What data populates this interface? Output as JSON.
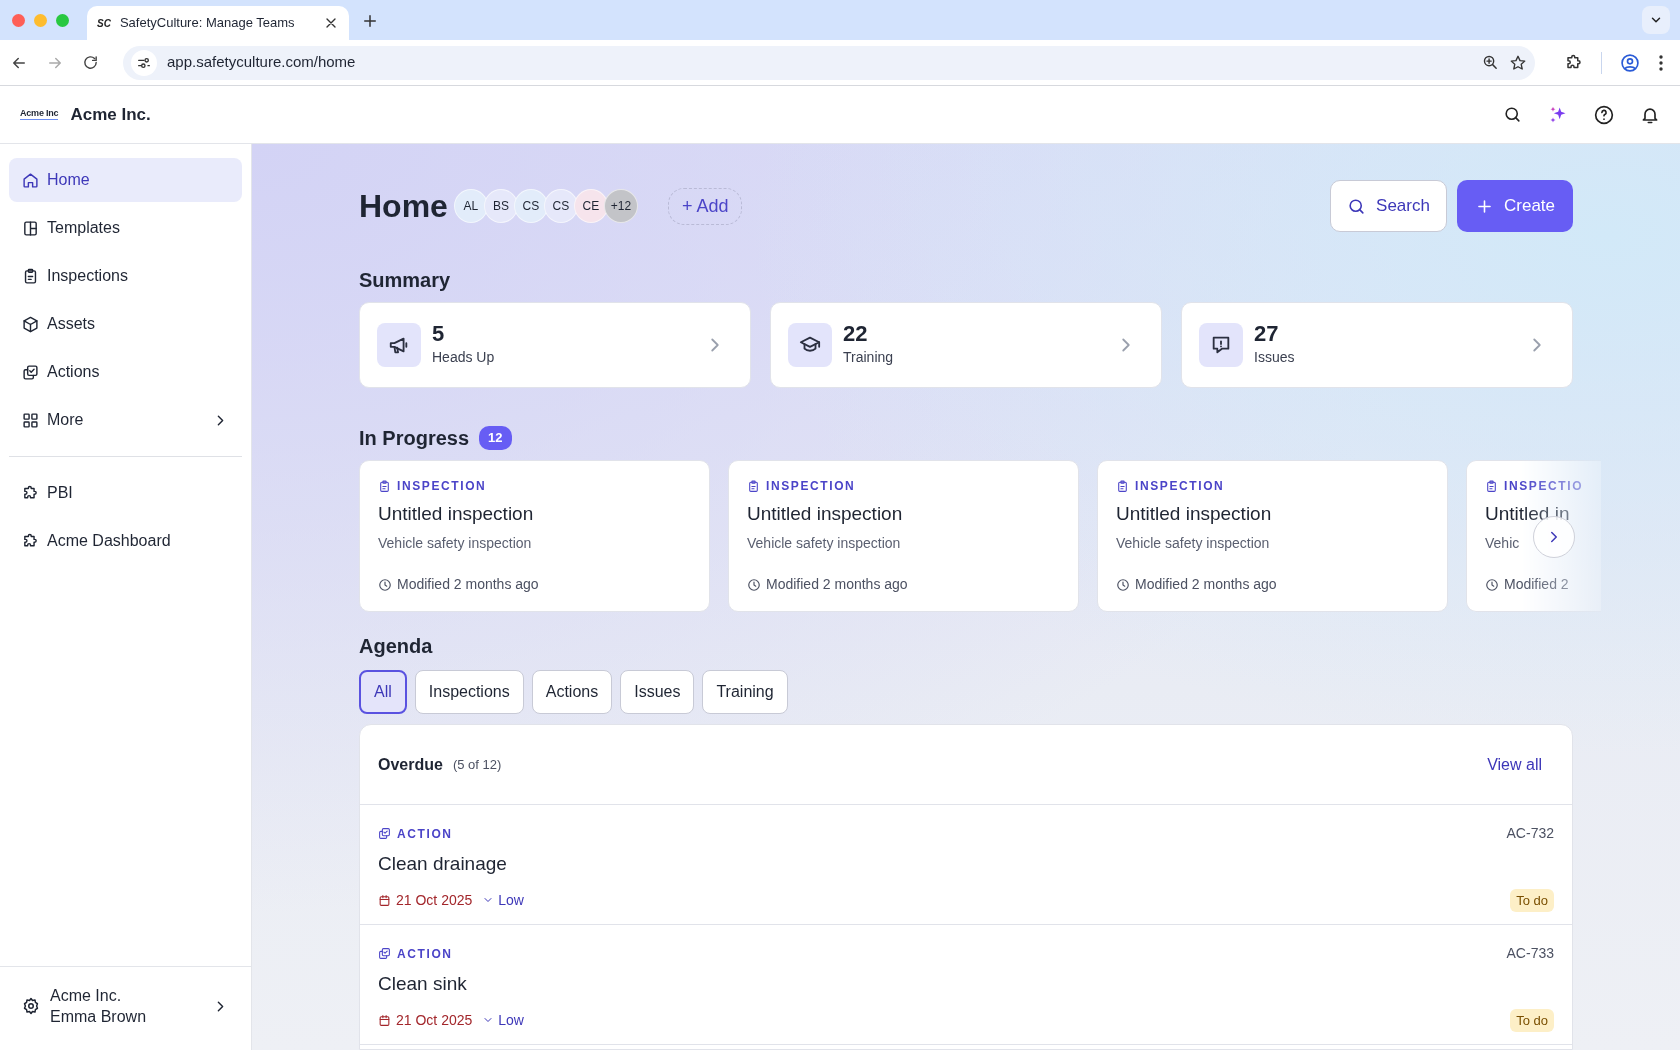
{
  "browser": {
    "favicon_text": "SC",
    "tab_title": "SafetyCulture: Manage Teams",
    "url": "app.safetyculture.com/home"
  },
  "app_header": {
    "logo_text": "Acme Inc",
    "org_name": "Acme Inc."
  },
  "sidebar": {
    "items": [
      {
        "label": "Home",
        "selected": true,
        "has_submenu": false
      },
      {
        "label": "Templates",
        "selected": false,
        "has_submenu": false
      },
      {
        "label": "Inspections",
        "selected": false,
        "has_submenu": false
      },
      {
        "label": "Assets",
        "selected": false,
        "has_submenu": false
      },
      {
        "label": "Actions",
        "selected": false,
        "has_submenu": false
      },
      {
        "label": "More",
        "selected": false,
        "has_submenu": true
      }
    ],
    "apps": [
      {
        "label": "PBI",
        "selected": false
      },
      {
        "label": "Acme Dashboard",
        "selected": false
      }
    ],
    "footer": {
      "org": "Acme Inc.",
      "user": "Emma Brown"
    }
  },
  "page": {
    "title": "Home",
    "members": [
      {
        "initials": "AL",
        "color": "#e2ecfa"
      },
      {
        "initials": "BS",
        "color": "#e6e8fa"
      },
      {
        "initials": "CS",
        "color": "#e2ecfa"
      },
      {
        "initials": "CS",
        "color": "#e6e8fa"
      },
      {
        "initials": "CE",
        "color": "#f6e4ec"
      },
      {
        "initials": "+12",
        "color": "#c3c4c8"
      }
    ],
    "add_label": "+ Add",
    "search_label": "Search",
    "create_label": "Create"
  },
  "summary": {
    "title": "Summary",
    "cards": [
      {
        "count": "5",
        "label": "Heads Up"
      },
      {
        "count": "22",
        "label": "Training"
      },
      {
        "count": "27",
        "label": "Issues"
      }
    ]
  },
  "in_progress": {
    "title": "In Progress",
    "count": "12",
    "cards": [
      {
        "type": "INSPECTION",
        "title": "Untitled inspection",
        "subtitle": "Vehicle safety inspection",
        "modified": "Modified 2 months ago"
      },
      {
        "type": "INSPECTION",
        "title": "Untitled inspection",
        "subtitle": "Vehicle safety inspection",
        "modified": "Modified 2 months ago"
      },
      {
        "type": "INSPECTION",
        "title": "Untitled inspection",
        "subtitle": "Vehicle safety inspection",
        "modified": "Modified 2 months ago"
      },
      {
        "type": "INSPECTIO",
        "title": "Untitled in",
        "subtitle": "Vehic",
        "modified": "Modified 2"
      }
    ]
  },
  "agenda": {
    "title": "Agenda",
    "filters": [
      {
        "label": "All",
        "selected": true
      },
      {
        "label": "Inspections",
        "selected": false
      },
      {
        "label": "Actions",
        "selected": false
      },
      {
        "label": "Issues",
        "selected": false
      },
      {
        "label": "Training",
        "selected": false
      }
    ],
    "overdue": {
      "title": "Overdue",
      "count": "(5 of 12)",
      "view_all": "View all",
      "rows": [
        {
          "type": "ACTION",
          "title": "Clean drainage",
          "ref": "AC-732",
          "due": "21 Oct 2025",
          "priority": "Low",
          "status": "To do"
        },
        {
          "type": "ACTION",
          "title": "Clean sink",
          "ref": "AC-733",
          "due": "21 Oct 2025",
          "priority": "Low",
          "status": "To do"
        }
      ]
    }
  }
}
